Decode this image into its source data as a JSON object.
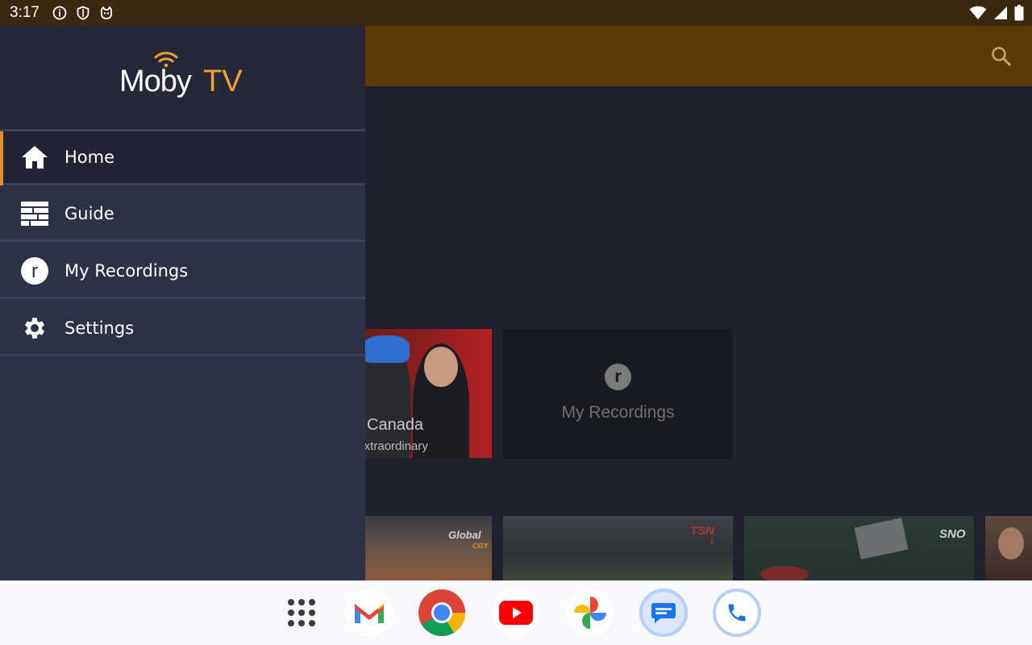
{
  "status_bar": {
    "time": "3:17",
    "icons": [
      "info-icon",
      "shield-icon",
      "cat-icon"
    ],
    "right_icons": [
      "wifi-icon",
      "signal-icon",
      "battery-icon"
    ]
  },
  "logo": {
    "part1": "Moby",
    "part2": "TV"
  },
  "nav": [
    {
      "label": "Home",
      "icon": "home-icon",
      "active": true
    },
    {
      "label": "Guide",
      "icon": "guide-icon",
      "active": false
    },
    {
      "label": "My Recordings",
      "icon": "recordings-icon",
      "active": false
    },
    {
      "label": "Settings",
      "icon": "settings-icon",
      "active": false
    }
  ],
  "background": {
    "tile1": {
      "title": "Canada",
      "subtitle": "ary to Extraordinary"
    },
    "tile2": {
      "icon_letter": "r",
      "label": "My Recordings"
    },
    "thumbs": [
      {
        "brand": "Global",
        "sub": "CGY"
      },
      {
        "brand": "TSN",
        "sub": "1"
      },
      {
        "brand": "SNO",
        "sub": ""
      }
    ]
  },
  "taskbar": {
    "apps": [
      "app-drawer-icon",
      "gmail-icon",
      "chrome-icon",
      "youtube-icon",
      "photos-icon",
      "messages-icon",
      "phone-icon"
    ]
  },
  "colors": {
    "accent": "#f0a033",
    "appbar": "#5c3a06",
    "drawer": "#2d3145",
    "drawer_header": "#252837"
  }
}
